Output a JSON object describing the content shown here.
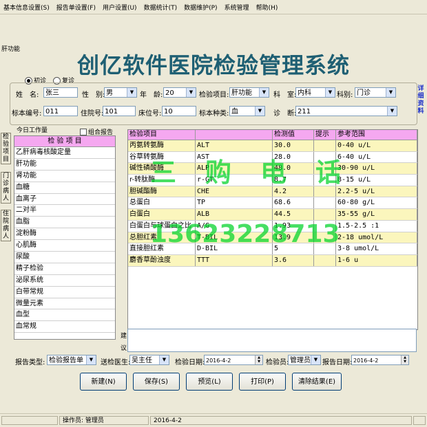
{
  "menu": [
    "基本信息设置(S)",
    "报告单设置(F)",
    "用户设置(U)",
    "数据统计(T)",
    "数据维护(P)",
    "系统管理",
    "帮助(H)"
  ],
  "module_label": "肝功能",
  "title": "创亿软件医院检验管理系统",
  "visit_type": {
    "options": [
      "初诊",
      "复诊"
    ],
    "selected": "初诊"
  },
  "form": {
    "name_label": "姓　名:",
    "name_value": "张三",
    "sex_label": "性　别:",
    "sex_value": "男",
    "age_label": "年　龄:",
    "age_value": "20",
    "test_item_label": "检验项目:",
    "test_item_value": "肝功能",
    "dept_label": "科　室:",
    "dept_value": "内科",
    "category_label": "科别:",
    "category_value": "门诊",
    "specimen_no_label": "标本编号:",
    "specimen_no_value": "011",
    "inpatient_no_label": "住院号:",
    "inpatient_no_value": "101",
    "bed_no_label": "床位号:",
    "bed_no_value": "10",
    "specimen_type_label": "标本种类:",
    "specimen_type_value": "血",
    "diagnosis_label": "诊　断:",
    "diagnosis_value": "211"
  },
  "side_detail": "详细资料",
  "vertical_tabs": [
    "检验项目",
    "门诊病人",
    "住院病人"
  ],
  "today_work_label": "今日工作量",
  "combo_report_label": "组合报告",
  "test_list": {
    "header": "检 验 项 目",
    "items": [
      "乙肝病毒核酸定量",
      "肝功能",
      "肾功能",
      "血糖",
      "血离子",
      "二对半",
      "血脂",
      "淀粉酶",
      "心肌酶",
      "尿酸",
      "精子检验",
      "泌尿系统",
      "白带常规",
      "微量元素",
      "血型",
      "血常规"
    ]
  },
  "results": {
    "headers": [
      "检验项目",
      "",
      "检测值",
      "提示",
      "参考范围"
    ],
    "rows": [
      {
        "name": "丙氨转氨酶",
        "code": "ALT",
        "value": "30.0",
        "hint": "",
        "range": "0-40 u/L",
        "highlight": true
      },
      {
        "name": "谷草转氨酶",
        "code": "AST",
        "value": "28.0",
        "hint": "",
        "range": "6-40 u/L",
        "highlight": false
      },
      {
        "name": "碱性磷酸酶",
        "code": "ALP",
        "value": "48.0",
        "hint": "",
        "range": "30-90 u/L",
        "highlight": true
      },
      {
        "name": "r-转肽酶",
        "code": "r-GT",
        "value": "8.7",
        "hint": "",
        "range": "8-15 u/L",
        "highlight": false
      },
      {
        "name": "胆碱酯酶",
        "code": "CHE",
        "value": "4.2",
        "hint": "",
        "range": "2.2-5 u/L",
        "highlight": true
      },
      {
        "name": "总蛋白",
        "code": "TP",
        "value": "68.6",
        "hint": "",
        "range": "60-80 g/L",
        "highlight": false
      },
      {
        "name": "白蛋白",
        "code": "ALB",
        "value": "44.5",
        "hint": "",
        "range": "35-55 g/L",
        "highlight": true
      },
      {
        "name": "白蛋白与球蛋白之比",
        "code": "A/G",
        "value": "1.93",
        "hint": "",
        "range": "1.5-2.5 :1",
        "highlight": false
      },
      {
        "name": "总胆红素",
        "code": "T-BIL",
        "value": "13.9",
        "hint": "",
        "range": "2-18 umol/L",
        "highlight": true
      },
      {
        "name": "直接胆红素",
        "code": "D-BIL",
        "value": "5",
        "hint": "",
        "range": "3-8 umol/L",
        "highlight": false
      },
      {
        "name": "麝香草酚浊度",
        "code": "TTT",
        "value": "3.6",
        "hint": "",
        "range": "1-6 u",
        "highlight": true
      }
    ]
  },
  "advice_label": "建议",
  "bottom": {
    "report_type_label": "报告类型:",
    "report_type_value": "检验报告单",
    "doctor_label": "送检医生:",
    "doctor_value": "吴主任",
    "test_date_label": "检验日期:",
    "test_date_value": "2016-4-2",
    "tester_label": "检验员:",
    "tester_value": "管理员",
    "report_date_label": "报告日期:",
    "report_date_value": "2016-4-2"
  },
  "buttons": {
    "new": "新建(N)",
    "save": "保存(S)",
    "preview": "预览(L)",
    "print": "打印(P)",
    "clear": "清除结果(E)"
  },
  "status": {
    "operator_label": "操作员:",
    "operator_value": "管理员",
    "date": "2016-4-2"
  },
  "watermark": {
    "line1": "三　购　电　话",
    "line2": "13623228713",
    "color": "#00d228"
  },
  "colors": {
    "accent_pink": "#f5a8f0",
    "row_highlight": "#fbf6bd",
    "title_color": "#1e5f73",
    "detail_link": "#1a2ec8"
  }
}
